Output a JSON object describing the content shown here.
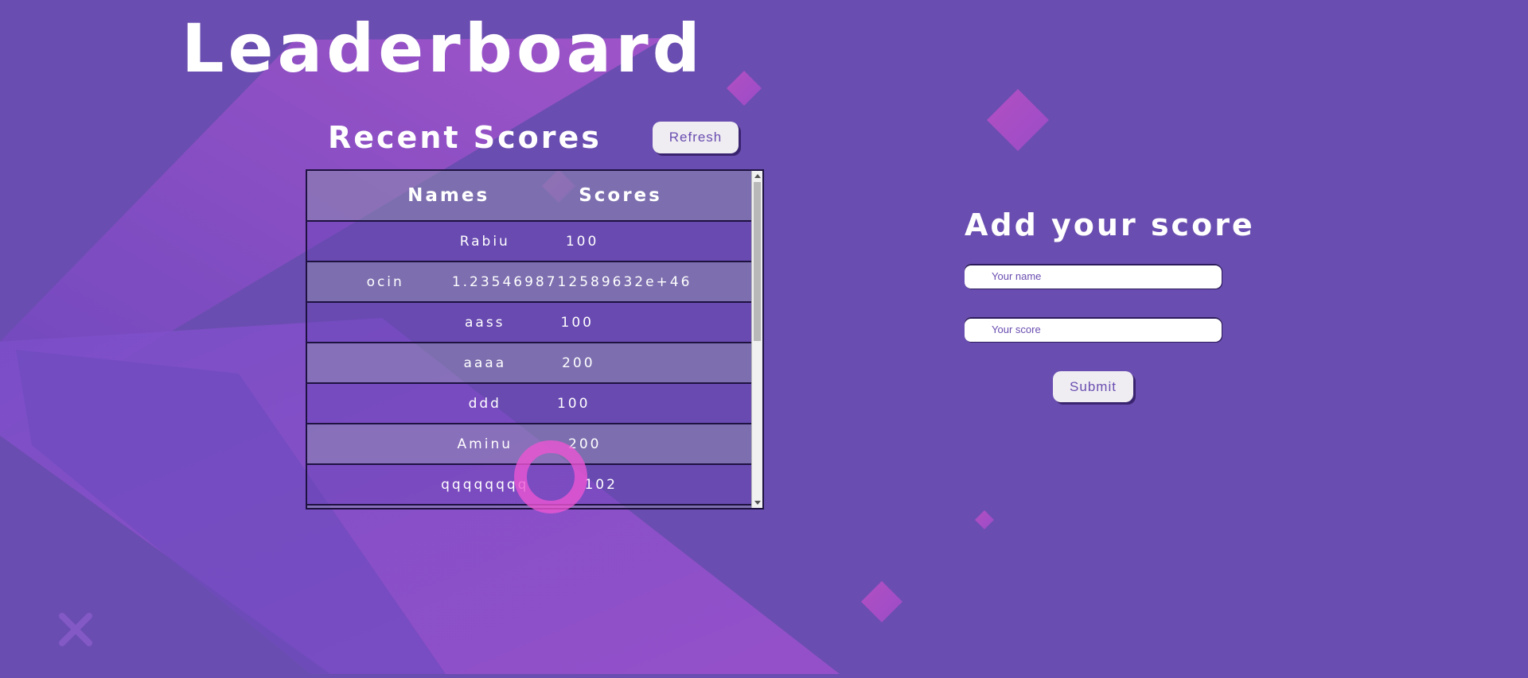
{
  "page": {
    "title": "Leaderboard"
  },
  "recent_scores": {
    "title": "Recent Scores",
    "refresh_label": "Refresh",
    "columns": [
      "Names",
      "Scores"
    ],
    "rows": [
      {
        "name": "Rabiu",
        "score": "100"
      },
      {
        "name": "ocin",
        "score": "1.2354698712589632e+46"
      },
      {
        "name": "aass",
        "score": "100"
      },
      {
        "name": "aaaa",
        "score": "200"
      },
      {
        "name": "ddd",
        "score": "100"
      },
      {
        "name": "Aminu",
        "score": "200"
      },
      {
        "name": "qqqqqqqq",
        "score": "102"
      }
    ]
  },
  "add_score": {
    "title": "Add your score",
    "name_placeholder": "Your name",
    "score_placeholder": "Your score",
    "submit_label": "Submit"
  },
  "colors": {
    "background": "#6a4db0",
    "accent_pink": "#d957c8",
    "button_bg": "#efedf2"
  }
}
